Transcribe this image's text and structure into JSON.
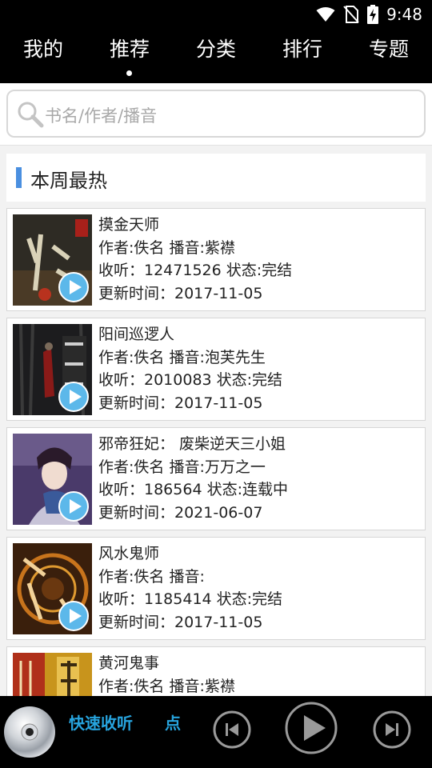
{
  "status": {
    "time": "9:48"
  },
  "nav": {
    "tabs": [
      "我的",
      "推荐",
      "分类",
      "排行",
      "专题"
    ],
    "active": 1
  },
  "search": {
    "placeholder": "书名/作者/播音"
  },
  "section": {
    "title": "本周最热"
  },
  "books": [
    {
      "title": "摸金天师",
      "meta": "作者:佚名 播音:紫襟",
      "stats": "收听：12471526 状态:完结",
      "updated": "更新时间：2017-11-05"
    },
    {
      "title": "阳间巡逻人",
      "meta": "作者:佚名 播音:泡芙先生",
      "stats": "收听：2010083 状态:完结",
      "updated": "更新时间：2017-11-05"
    },
    {
      "title": "邪帝狂妃： 废柴逆天三小姐",
      "meta": "作者:佚名 播音:万万之一",
      "stats": "收听：186564 状态:连载中",
      "updated": "更新时间：2021-06-07"
    },
    {
      "title": "风水鬼师",
      "meta": "作者:佚名 播音:",
      "stats": "收听：1185414 状态:完结",
      "updated": "更新时间：2017-11-05"
    },
    {
      "title": "黄河鬼事",
      "meta": "作者:佚名 播音:紫襟",
      "stats": "",
      "updated": ""
    }
  ],
  "player": {
    "marquee": "快速收听　　点"
  },
  "colors": {
    "accent": "#4a8fe0",
    "marquee": "#27a4de",
    "bar": "#000000"
  }
}
